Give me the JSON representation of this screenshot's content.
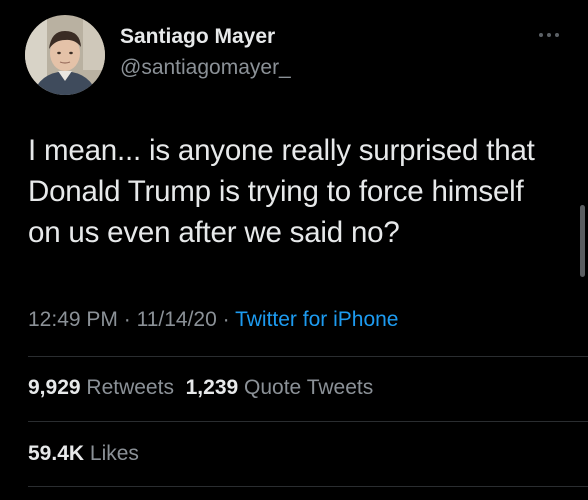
{
  "author": {
    "name": "Santiago Mayer",
    "handle": "@santiagomayer_"
  },
  "tweet": {
    "text": "I mean... is anyone really surprised that Donald Trump is trying to force himself on us even after we said no?",
    "time": "12:49 PM",
    "separator": "·",
    "date": "11/14/20",
    "source": "Twitter for iPhone"
  },
  "stats": {
    "retweets_count": "9,929",
    "retweets_label": "Retweets",
    "quotes_count": "1,239",
    "quotes_label": "Quote Tweets",
    "likes_count": "59.4K",
    "likes_label": "Likes"
  },
  "icons": {
    "more": "more-horizontal-icon"
  },
  "colors": {
    "background": "#000000",
    "primary_text": "#e7e9ea",
    "secondary_text": "#8b9197",
    "link": "#1d9bf0",
    "divider": "#2a2d30"
  }
}
